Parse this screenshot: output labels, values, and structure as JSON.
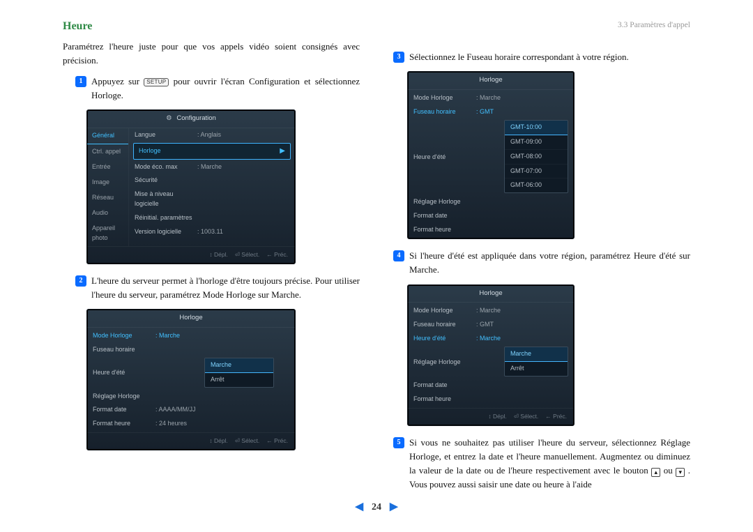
{
  "breadcrumb": "3.3 Paramètres d'appel",
  "title": "Heure",
  "intro": "Paramétrez l'heure juste pour que vos appels vidéo soient consignés avec précision.",
  "steps": {
    "s1a": "Appuyez sur ",
    "s1_key": "SETUP",
    "s1b": " pour ouvrir l'écran Configuration et sélectionnez Horloge.",
    "s2": "L'heure du serveur permet à l'horloge d'être toujours précise. Pour utiliser l'heure du serveur, paramétrez Mode Horloge sur Marche.",
    "s3": "Sélectionnez le Fuseau horaire correspondant à votre région.",
    "s4": "Si l'heure d'été est appliquée dans votre région, paramétrez Heure d'été sur Marche.",
    "s5a": "Si vous ne souhaitez pas utiliser l'heure du serveur, sélectionnez Réglage Horloge, et entrez la date et l'heure manuellement. Augmentez ou diminuez la valeur de la date ou de l'heure respectivement avec le bouton ",
    "s5b": " ou ",
    "s5c": " . Vous pouvez aussi saisir une date ou heure à l'aide"
  },
  "osd1": {
    "title": "Configuration",
    "tabs": [
      "Général",
      "Ctrl. appel",
      "Entrée",
      "Image",
      "Réseau",
      "Audio",
      "Appareil photo"
    ],
    "rows": [
      {
        "lab": "Langue",
        "val": ": Anglais"
      },
      {
        "lab": "Horloge",
        "val": "",
        "hi": true,
        "arrow": true
      },
      {
        "lab": "Mode éco. max",
        "val": ": Marche"
      },
      {
        "lab": "Sécurité",
        "val": ""
      },
      {
        "lab": "Mise à niveau logicielle",
        "val": ""
      },
      {
        "lab": "Réinitial. paramètres",
        "val": ""
      },
      {
        "lab": "Version logicielle",
        "val": ": 1003.11"
      }
    ]
  },
  "osd2": {
    "title": "Horloge",
    "rows": [
      {
        "lab": "Mode Horloge",
        "val": ": Marche",
        "link": true
      },
      {
        "lab": "Fuseau horaire",
        "val": ""
      },
      {
        "lab": "Heure d'été",
        "val": ""
      },
      {
        "lab": "Réglage Horloge",
        "val": ""
      },
      {
        "lab": "Format date",
        "val": ": AAAA/MM/JJ"
      },
      {
        "lab": "Format heure",
        "val": ": 24 heures"
      }
    ],
    "dropdown": [
      "Marche",
      "Arrêt"
    ],
    "dropdown_sel": 0
  },
  "osd3": {
    "title": "Horloge",
    "rows": [
      {
        "lab": "Mode Horloge",
        "val": ": Marche"
      },
      {
        "lab": "Fuseau horaire",
        "val": ": GMT",
        "link": true
      },
      {
        "lab": "Heure d'été",
        "val": ""
      },
      {
        "lab": "Réglage Horloge",
        "val": ""
      },
      {
        "lab": "Format date",
        "val": ""
      },
      {
        "lab": "Format heure",
        "val": ""
      }
    ],
    "dropdown": [
      "GMT-10:00",
      "GMT-09:00",
      "GMT-08:00",
      "GMT-07:00",
      "GMT-06:00"
    ],
    "dropdown_sel": 0
  },
  "osd4": {
    "title": "Horloge",
    "rows": [
      {
        "lab": "Mode Horloge",
        "val": ": Marche"
      },
      {
        "lab": "Fuseau horaire",
        "val": ": GMT"
      },
      {
        "lab": "Heure d'été",
        "val": ": Marche",
        "link": true
      },
      {
        "lab": "Réglage Horloge",
        "val": ""
      },
      {
        "lab": "Format date",
        "val": ""
      },
      {
        "lab": "Format heure",
        "val": ""
      }
    ],
    "dropdown": [
      "Marche",
      "Arrêt"
    ],
    "dropdown_sel": 0
  },
  "foot": {
    "a": "↕ Dépl.",
    "b": "⏎ Sélect.",
    "c": "← Préc."
  },
  "page_num": "24"
}
